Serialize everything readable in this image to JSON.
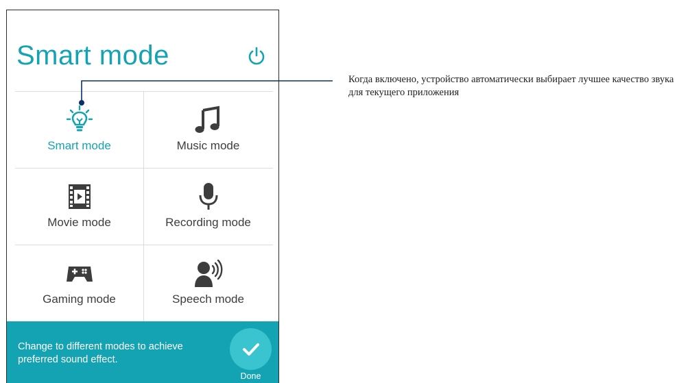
{
  "screen": {
    "title": "Smart mode",
    "power_icon": "power-icon"
  },
  "modes": [
    {
      "label": "Smart mode",
      "icon": "lightbulb-icon",
      "active": true
    },
    {
      "label": "Music mode",
      "icon": "music-note-icon",
      "active": false
    },
    {
      "label": "Movie mode",
      "icon": "film-icon",
      "active": false
    },
    {
      "label": "Recording mode",
      "icon": "microphone-icon",
      "active": false
    },
    {
      "label": "Gaming mode",
      "icon": "gamepad-icon",
      "active": false
    },
    {
      "label": "Speech mode",
      "icon": "speaker-icon",
      "active": false
    }
  ],
  "footer": {
    "message": "Change to different modes to achieve preferred sound effect.",
    "done_label": "Done",
    "done_icon": "checkmark-icon"
  },
  "annotation": {
    "text": "Когда включено, устройство автоматически выбирает лучшее качество звука для текущего приложения"
  },
  "colors": {
    "accent": "#14a3b2",
    "done_button": "#3ac4cf",
    "callout": "#0b2f6b"
  }
}
